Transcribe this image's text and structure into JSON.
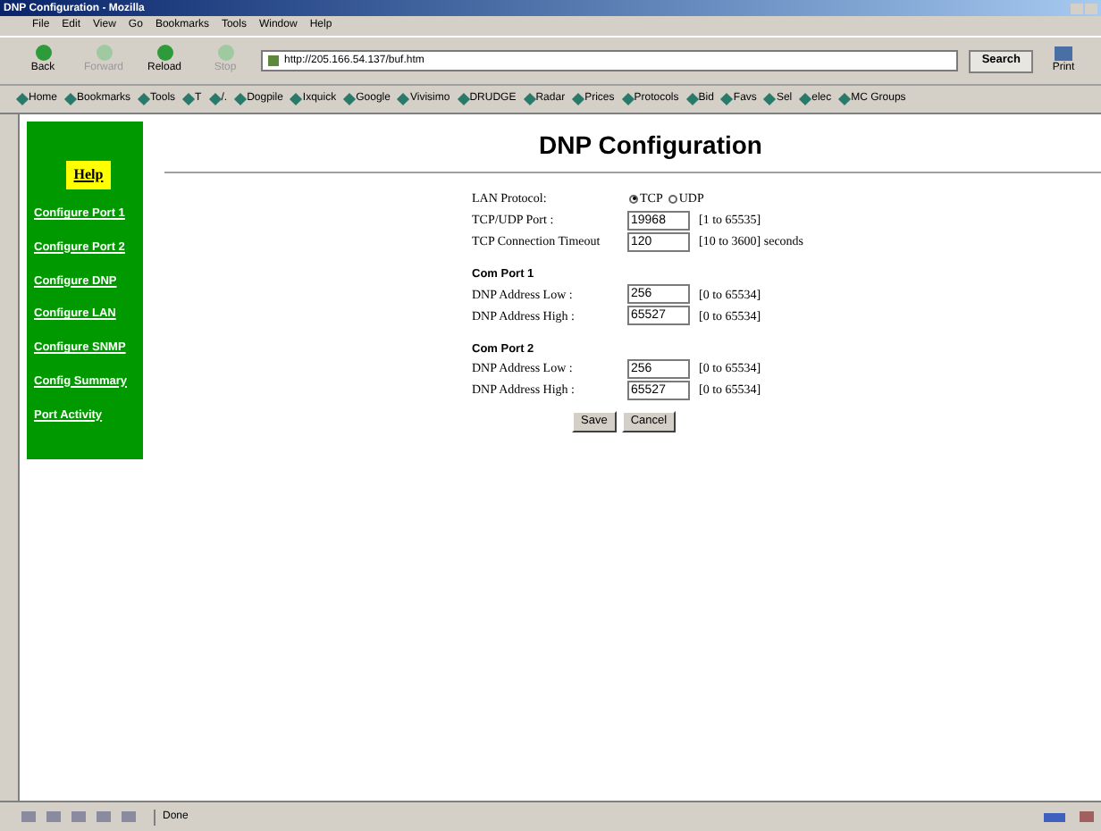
{
  "window": {
    "title": "DNP Configuration - Mozilla"
  },
  "menu": [
    "File",
    "Edit",
    "View",
    "Go",
    "Bookmarks",
    "Tools",
    "Window",
    "Help"
  ],
  "nav_buttons": [
    {
      "label": "Back",
      "disabled": false
    },
    {
      "label": "Forward",
      "disabled": true
    },
    {
      "label": "Reload",
      "disabled": false
    },
    {
      "label": "Stop",
      "disabled": true
    }
  ],
  "address": {
    "value": "http://205.166.54.137/buf.htm"
  },
  "search_button": "Search",
  "print_button": "Print",
  "bookmarks": [
    "Home",
    "Bookmarks",
    "Tools",
    "T",
    "/.",
    "Dogpile",
    "Ixquick",
    "Google",
    "Vivisimo",
    "DRUDGE",
    "Radar",
    "Prices",
    "Protocols",
    "Bid",
    "Favs",
    "Sel",
    "elec",
    "MC Groups"
  ],
  "sidebar": {
    "help": "Help",
    "links": [
      "Configure Port 1",
      "Configure Port 2",
      "Configure DNP",
      "Configure LAN",
      "Configure SNMP",
      "Config Summary",
      "Port Activity"
    ]
  },
  "page_title": "DNP Configuration",
  "lan_protocol": {
    "label": "LAN Protocol:",
    "options": [
      {
        "label": "TCP",
        "selected": true
      },
      {
        "label": "UDP",
        "selected": false
      }
    ]
  },
  "general_fields": [
    {
      "label": "TCP/UDP Port :",
      "value": "19968",
      "range": "[1 to 65535]"
    },
    {
      "label": "TCP Connection Timeout",
      "value": "120",
      "range": "[10 to 3600] seconds"
    }
  ],
  "sections": [
    {
      "title": "Com Port 1",
      "fields": [
        {
          "label": "DNP Address Low :",
          "value": "256",
          "range": "[0 to 65534]"
        },
        {
          "label": "DNP Address High :",
          "value": "65527",
          "range": "[0 to 65534]"
        }
      ]
    },
    {
      "title": "Com Port 2",
      "fields": [
        {
          "label": "DNP Address Low :",
          "value": "256",
          "range": "[0 to 65534]"
        },
        {
          "label": "DNP Address High :",
          "value": "65527",
          "range": "[0 to 65534]"
        }
      ]
    }
  ],
  "buttons": [
    "Save",
    "Cancel"
  ],
  "status_bar": {
    "text": "Done"
  }
}
